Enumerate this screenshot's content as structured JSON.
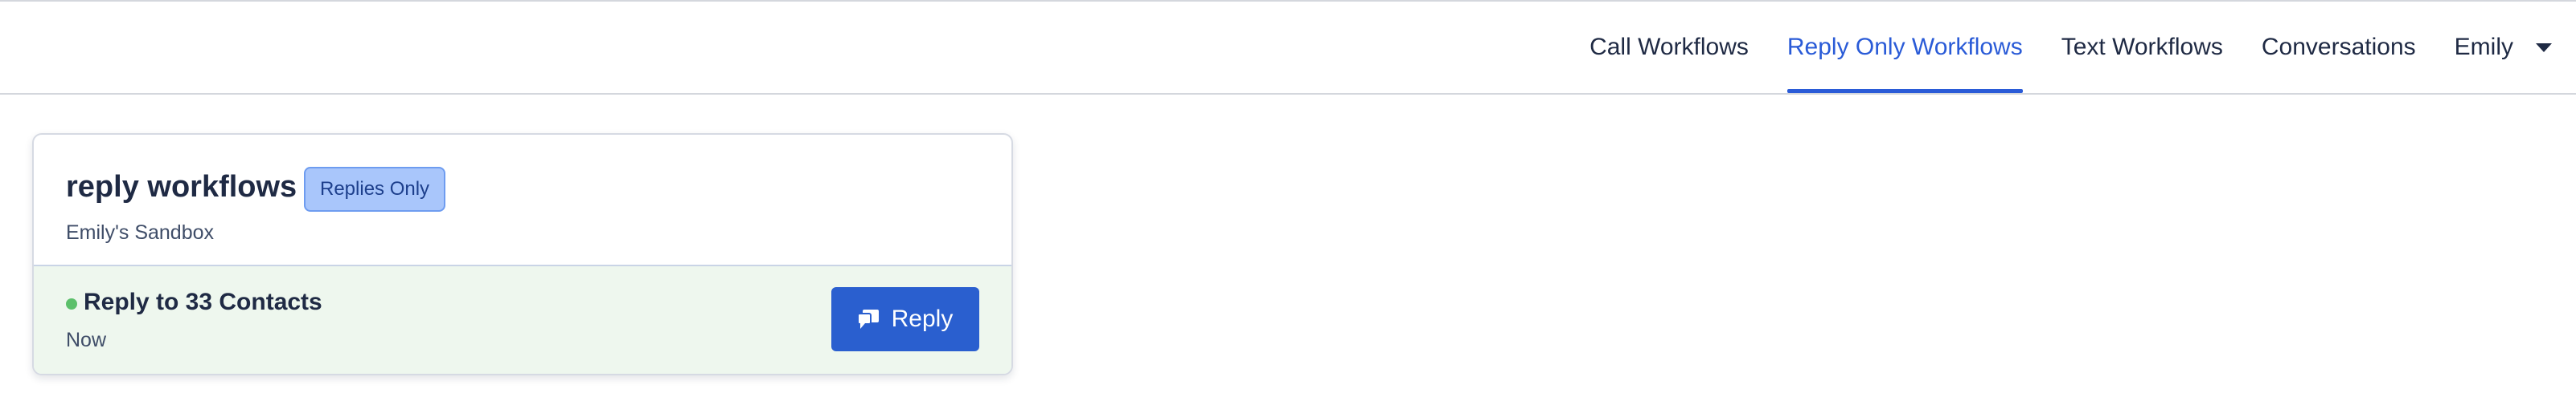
{
  "nav": {
    "items": [
      {
        "label": "Call Workflows",
        "active": false
      },
      {
        "label": "Reply Only Workflows",
        "active": true
      },
      {
        "label": "Text Workflows",
        "active": false
      },
      {
        "label": "Conversations",
        "active": false
      }
    ],
    "user": {
      "name": "Emily",
      "icon": "chevron-down-icon"
    },
    "active_color": "#2a5bd7"
  },
  "card": {
    "title": "reply workflows",
    "badge": "Replies Only",
    "subtitle": "Emily's Sandbox",
    "footer": {
      "status_color": "#5cc06b",
      "title": "Reply to 33 Contacts",
      "time": "Now",
      "button_label": "Reply",
      "button_icon": "chat-bubbles-icon"
    }
  }
}
